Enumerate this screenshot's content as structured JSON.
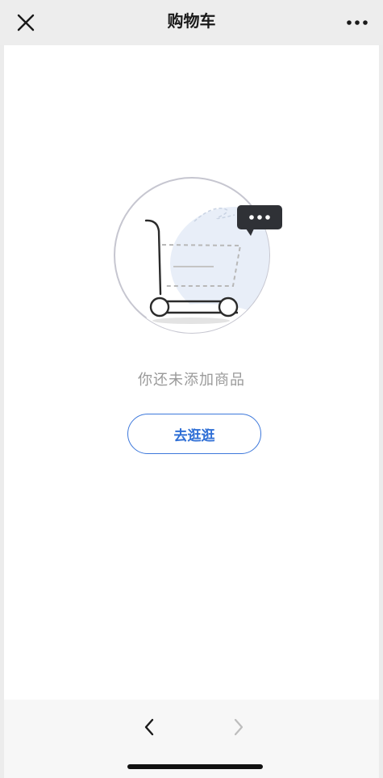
{
  "header": {
    "title": "购物车",
    "close_icon": "close-icon",
    "more_icon": "more-icon"
  },
  "empty_state": {
    "illustration": "empty-cart-illustration",
    "message": "你还未添加商品",
    "browse_button_label": "去逛逛"
  },
  "bottom_nav": {
    "back_icon": "chevron-left-icon",
    "forward_icon": "chevron-right-icon",
    "forward_enabled": false
  },
  "colors": {
    "accent": "#2f6fd6",
    "header_bg": "#ededed",
    "content_bg": "#ffffff",
    "muted_text": "#9a9a9a"
  }
}
